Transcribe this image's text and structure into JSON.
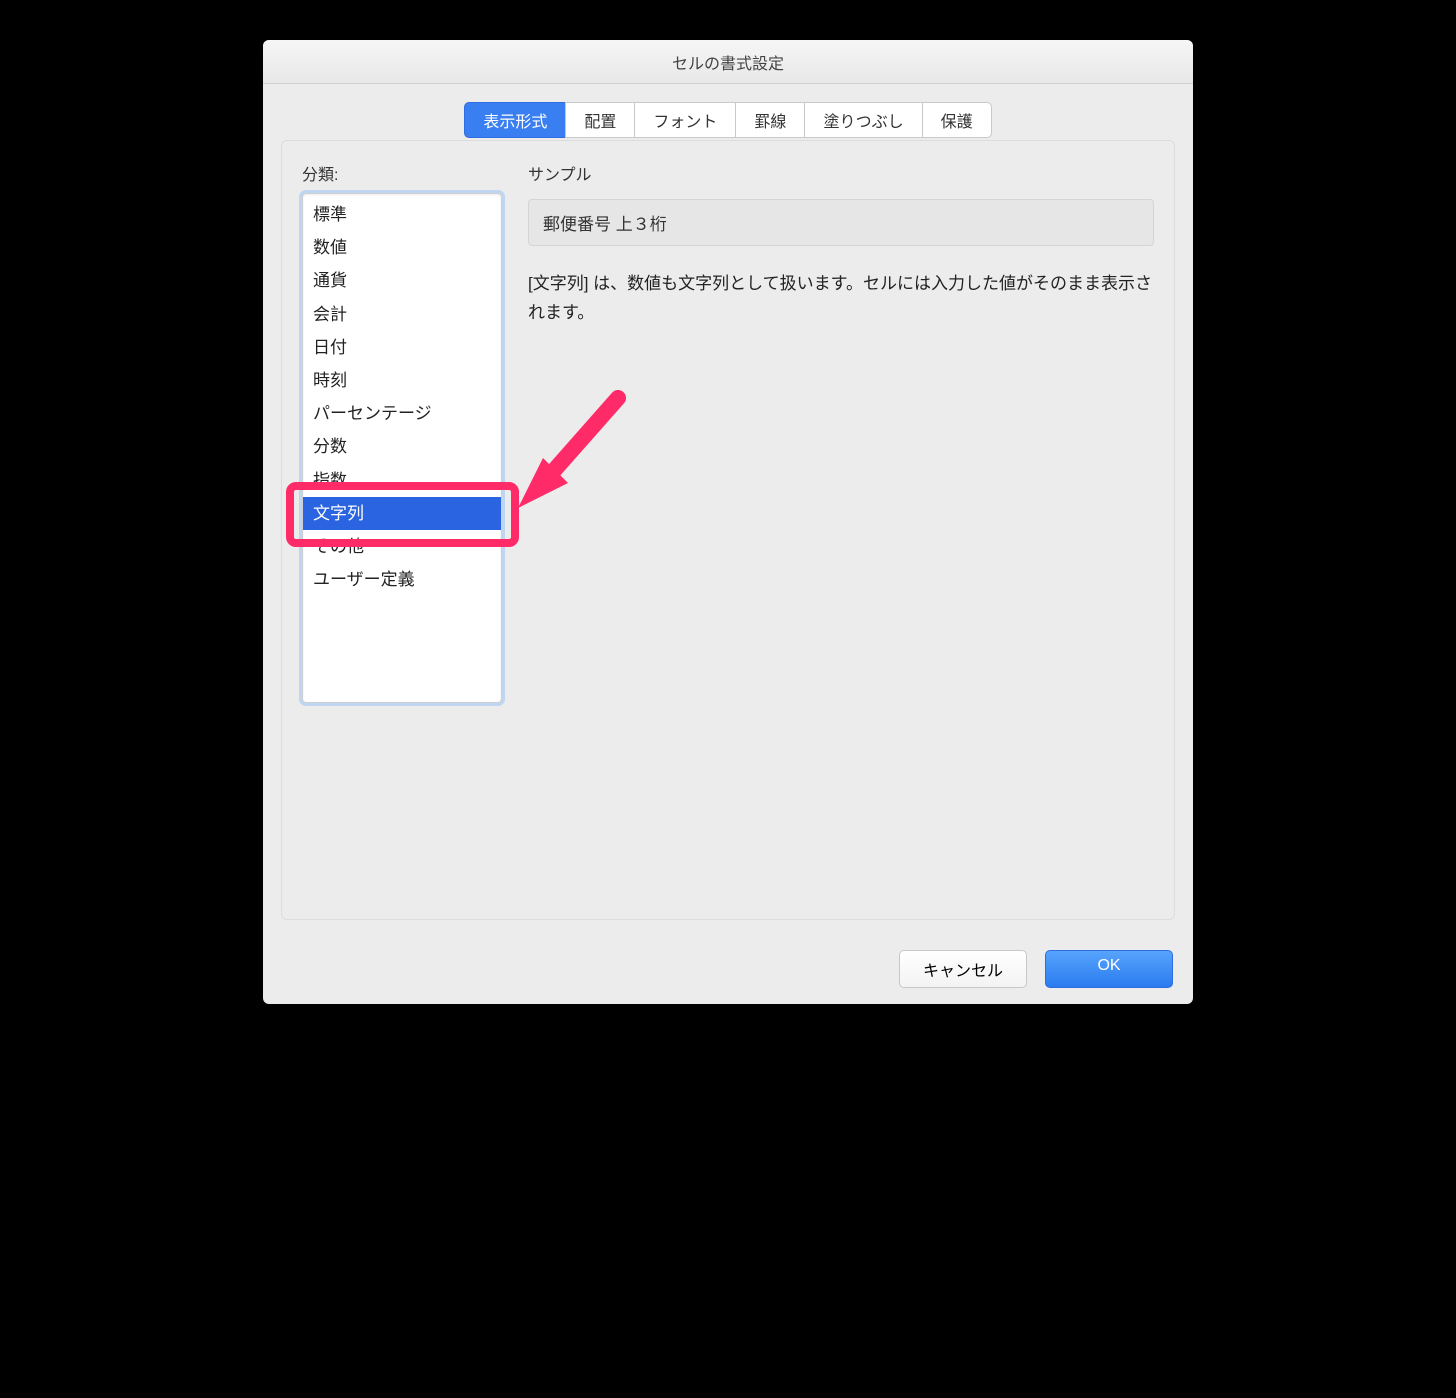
{
  "window": {
    "title": "セルの書式設定"
  },
  "tabs": [
    {
      "label": "表示形式",
      "selected": true
    },
    {
      "label": "配置",
      "selected": false
    },
    {
      "label": "フォント",
      "selected": false
    },
    {
      "label": "罫線",
      "selected": false
    },
    {
      "label": "塗りつぶし",
      "selected": false
    },
    {
      "label": "保護",
      "selected": false
    }
  ],
  "left": {
    "label": "分類:",
    "items": [
      {
        "label": "標準",
        "selected": false
      },
      {
        "label": "数値",
        "selected": false
      },
      {
        "label": "通貨",
        "selected": false
      },
      {
        "label": "会計",
        "selected": false
      },
      {
        "label": "日付",
        "selected": false
      },
      {
        "label": "時刻",
        "selected": false
      },
      {
        "label": "パーセンテージ",
        "selected": false
      },
      {
        "label": "分数",
        "selected": false
      },
      {
        "label": "指数",
        "selected": false
      },
      {
        "label": "文字列",
        "selected": true
      },
      {
        "label": "その他",
        "selected": false
      },
      {
        "label": "ユーザー定義",
        "selected": false
      }
    ]
  },
  "right": {
    "sample_label": "サンプル",
    "sample_value": "郵便番号 上３桁",
    "description": "[文字列] は、数値も文字列として扱います。セルには入力した値がそのまま表示されます。"
  },
  "buttons": {
    "cancel": "キャンセル",
    "ok": "OK"
  },
  "annotation": {
    "highlight_index": 9,
    "arrow_color": "#ff2b68"
  }
}
